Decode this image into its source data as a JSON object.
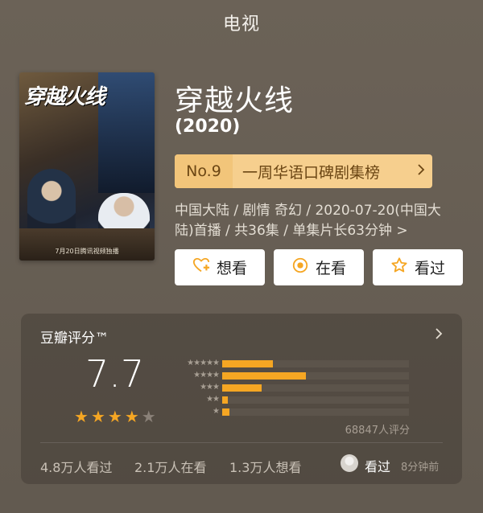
{
  "header": {
    "title": "电视"
  },
  "poster": {
    "title": "穿越火线",
    "credit": "7月20日腾讯视频独播"
  },
  "info": {
    "title": "穿越火线",
    "year": "(2020)",
    "rank_no": "No.9",
    "rank_text": "一周华语口碑剧集榜",
    "meta": "中国大陆 / 剧情 奇幻 / 2020-07-20(中国大陆)首播 / 共36集 / 单集片长63分钟",
    "meta_chevron": ">"
  },
  "actions": {
    "want": "想看",
    "watching": "在看",
    "watched": "看过"
  },
  "rating": {
    "title": "豆瓣评分™",
    "score": "7.7",
    "stars_filled": 4,
    "stars_total": 5,
    "distribution": [
      {
        "label": "★★★★★",
        "fraction": 0.27
      },
      {
        "label": "★★★★",
        "fraction": 0.45
      },
      {
        "label": "★★★",
        "fraction": 0.21
      },
      {
        "label": "★★",
        "fraction": 0.03
      },
      {
        "label": "★",
        "fraction": 0.04
      }
    ],
    "count": "68847人评分",
    "stats": {
      "watched": "4.8万人看过",
      "watching": "2.1万人在看",
      "want": "1.3万人想看"
    },
    "friend_action": "看过",
    "friend_time": "8分钟前"
  },
  "colors": {
    "background": "#675e54",
    "accent_star": "#f5a623",
    "rank_bg": "#f6cf8e",
    "rank_text": "#6b4614"
  },
  "icons": {
    "want": "heart-plus-icon",
    "watching": "target-icon",
    "watched": "star-outline-icon"
  }
}
